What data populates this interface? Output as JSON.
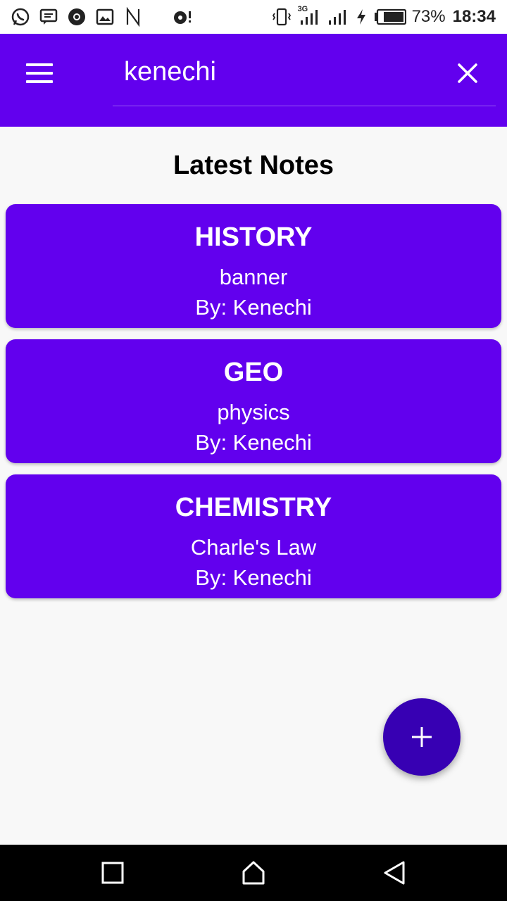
{
  "status_bar": {
    "left_icons": [
      "whatsapp-icon",
      "message-icon",
      "chrome-icon",
      "gallery-icon",
      "n-icon",
      "music-icon"
    ],
    "network_label": "3G",
    "battery_percent": "73%",
    "time": "18:34"
  },
  "app_bar": {
    "search_value": "kenechi",
    "menu_icon": "menu-icon",
    "close_icon": "close-icon",
    "color": "#6200ee"
  },
  "main": {
    "title": "Latest Notes",
    "notes": [
      {
        "subject": "HISTORY",
        "topic": "banner",
        "author": "By: Kenechi"
      },
      {
        "subject": "GEO",
        "topic": "physics",
        "author": "By: Kenechi"
      },
      {
        "subject": "CHEMISTRY",
        "topic": "Charle's Law",
        "author": "By: Kenechi"
      }
    ]
  },
  "fab": {
    "icon": "plus-icon",
    "color": "#3700b3"
  },
  "nav_bar": {
    "icons": [
      "recents-icon",
      "home-icon",
      "back-icon"
    ]
  }
}
